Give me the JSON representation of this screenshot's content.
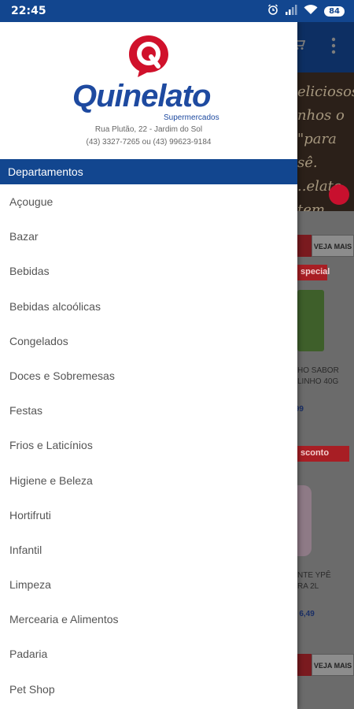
{
  "status_bar": {
    "time": "22:45",
    "battery": "84",
    "icons": [
      "alarm-icon",
      "signal-icon",
      "wifi-icon",
      "battery-icon"
    ]
  },
  "drawer": {
    "brand": {
      "name": "Quinelato",
      "tagline": "Supermercados",
      "address": "Rua Plutão, 22 - Jardim do Sol",
      "phones": "(43) 3327-7265 ou (43) 99623-9184"
    },
    "section_title": "Departamentos",
    "items": [
      {
        "label": "Açougue"
      },
      {
        "label": "Bazar"
      },
      {
        "label": "Bebidas"
      },
      {
        "label": "Bebidas alcoólicas"
      },
      {
        "label": "Congelados"
      },
      {
        "label": "Doces e Sobremesas"
      },
      {
        "label": "Festas"
      },
      {
        "label": "Frios e Laticínios"
      },
      {
        "label": "Higiene e Beleza"
      },
      {
        "label": "Hortifruti"
      },
      {
        "label": "Infantil"
      },
      {
        "label": "Limpeza"
      },
      {
        "label": "Mercearia e Alimentos"
      },
      {
        "label": "Padaria"
      },
      {
        "label": "Pet Shop"
      }
    ]
  },
  "background": {
    "banner_text": "eliciosos\nnhos o\n\"para\nsê.\n..elato tem.",
    "see_more_1": "VEJA MAIS",
    "tag_1": "special",
    "product_1": "HO SABOR\nLINHO 40G",
    "price_1": ",99",
    "tag_2": "sconto",
    "product_2": "NTE YPÊ\nRA 2L",
    "price_2": "$ 6,49",
    "see_more_2": "VEJA MAIS"
  },
  "colors": {
    "primary": "#12468f",
    "brand_blue": "#1e4aa0",
    "brand_red": "#c8102e"
  }
}
